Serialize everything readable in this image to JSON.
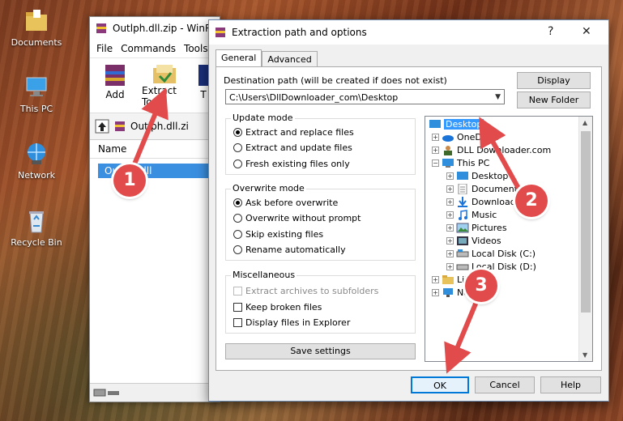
{
  "desktop": {
    "icons": [
      {
        "label": "Documents",
        "icon": "folder-icon"
      },
      {
        "label": "This PC",
        "icon": "computer-icon"
      },
      {
        "label": "Network",
        "icon": "network-icon"
      },
      {
        "label": "Recycle Bin",
        "icon": "recycle-bin-icon"
      }
    ]
  },
  "winrar": {
    "title": "Outlph.dll.zip - WinR",
    "menu": [
      "File",
      "Commands",
      "Tools"
    ],
    "toolbar": {
      "add": "Add",
      "extract_to": "Extract To",
      "third": "T"
    },
    "address": "Outlph.dll.zi",
    "column_name": "Name",
    "selected_file": "Outlph.dll"
  },
  "dialog": {
    "title": "Extraction path and options",
    "help": "?",
    "close": "✕",
    "tabs": [
      "General",
      "Advanced"
    ],
    "dest_label": "Destination path (will be created if does not exist)",
    "dest_value": "C:\\Users\\DllDownloader_com\\Desktop",
    "display_button": "Display",
    "new_folder_button": "New Folder",
    "update_mode": {
      "label": "Update mode",
      "options": [
        "Extract and replace files",
        "Extract and update files",
        "Fresh existing files only"
      ],
      "selected": 0
    },
    "overwrite_mode": {
      "label": "Overwrite mode",
      "options": [
        "Ask before overwrite",
        "Overwrite without prompt",
        "Skip existing files",
        "Rename automatically"
      ],
      "selected": 0
    },
    "misc": {
      "label": "Miscellaneous",
      "options": [
        "Extract archives to subfolders",
        "Keep broken files",
        "Display files in Explorer"
      ]
    },
    "save_settings": "Save settings",
    "ok": "OK",
    "cancel": "Cancel",
    "help_button": "Help",
    "tree": [
      {
        "label": "Desktop",
        "icon": "desktop-icon",
        "selected": true
      },
      {
        "label": "OneDrive",
        "icon": "onedrive-icon"
      },
      {
        "label": "DLL Downloader.com",
        "icon": "user-icon"
      },
      {
        "label": "This PC",
        "icon": "computer-icon"
      },
      {
        "label": "Desktop",
        "icon": "desktop-icon"
      },
      {
        "label": "Documents",
        "icon": "documents-icon"
      },
      {
        "label": "Downloads",
        "icon": "downloads-icon"
      },
      {
        "label": "Music",
        "icon": "music-icon"
      },
      {
        "label": "Pictures",
        "icon": "pictures-icon"
      },
      {
        "label": "Videos",
        "icon": "videos-icon"
      },
      {
        "label": "Local Disk (C:)",
        "icon": "drive-icon"
      },
      {
        "label": "Local Disk (D:)",
        "icon": "drive-icon"
      },
      {
        "label": "Libraries",
        "icon": "libraries-icon"
      },
      {
        "label": "Network",
        "icon": "network-icon"
      }
    ]
  },
  "annotations": {
    "step1": "1",
    "step2": "2",
    "step3": "3",
    "color": "#e24b4b"
  }
}
